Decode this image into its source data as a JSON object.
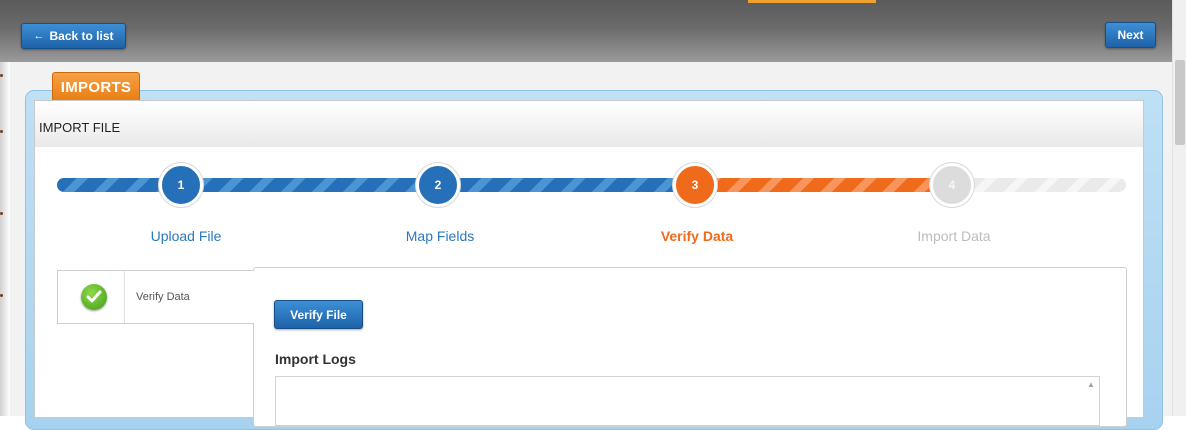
{
  "toolbar": {
    "back_label": "Back to list",
    "back_icon": "arrow-left-icon",
    "next_label": "Next"
  },
  "tab": {
    "label": "IMPORTS",
    "color": "#f08a24"
  },
  "panel": {
    "title": "IMPORT FILE"
  },
  "steps": [
    {
      "number": "1",
      "label": "Upload File",
      "state": "complete",
      "color": "#2570b8"
    },
    {
      "number": "2",
      "label": "Map Fields",
      "state": "complete",
      "color": "#2570b8"
    },
    {
      "number": "3",
      "label": "Verify Data",
      "state": "current",
      "color": "#f06a1c"
    },
    {
      "number": "4",
      "label": "Import Data",
      "state": "pending",
      "color": "#dcdcdc"
    }
  ],
  "side_tabs": [
    {
      "label": "Verify Data",
      "icon": "check-circle-icon",
      "active": true
    }
  ],
  "main": {
    "verify_button": "Verify File",
    "logs_title": "Import Logs",
    "logs_value": ""
  }
}
